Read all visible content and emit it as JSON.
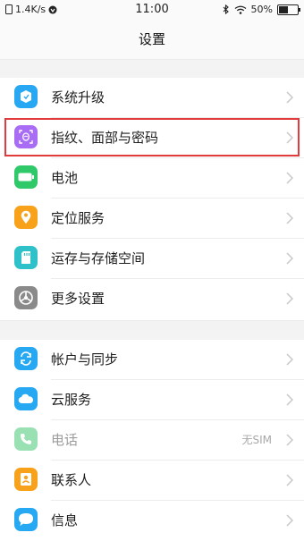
{
  "status_bar": {
    "net_speed": "1.4K/s",
    "time": "11:00",
    "battery": "50%",
    "battery_level_percent": 50
  },
  "header": {
    "title": "设置"
  },
  "groups": [
    {
      "items": [
        {
          "label": "系统升级",
          "icon": "system-update-icon",
          "color": "#28a7f2"
        },
        {
          "label": "指纹、面部与密码",
          "icon": "fingerprint-face-icon",
          "color": "#a86cf5",
          "highlighted": true
        },
        {
          "label": "电池",
          "icon": "battery-icon",
          "color": "#2fc96a"
        },
        {
          "label": "定位服务",
          "icon": "location-icon",
          "color": "#f7a21a"
        },
        {
          "label": "运存与存储空间",
          "icon": "storage-icon",
          "color": "#2fc1c9"
        },
        {
          "label": "更多设置",
          "icon": "more-settings-icon",
          "color": "#8a8a8a"
        }
      ]
    },
    {
      "items": [
        {
          "label": "帐户与同步",
          "icon": "account-sync-icon",
          "color": "#27a8f2"
        },
        {
          "label": "云服务",
          "icon": "cloud-icon",
          "color": "#27a8f2"
        },
        {
          "label": "电话",
          "icon": "phone-icon",
          "color": "#36c36a",
          "value": "无SIM",
          "disabled": true
        },
        {
          "label": "联系人",
          "icon": "contacts-icon",
          "color": "#f7a21a"
        },
        {
          "label": "信息",
          "icon": "message-icon",
          "color": "#27a8f2"
        }
      ]
    }
  ]
}
